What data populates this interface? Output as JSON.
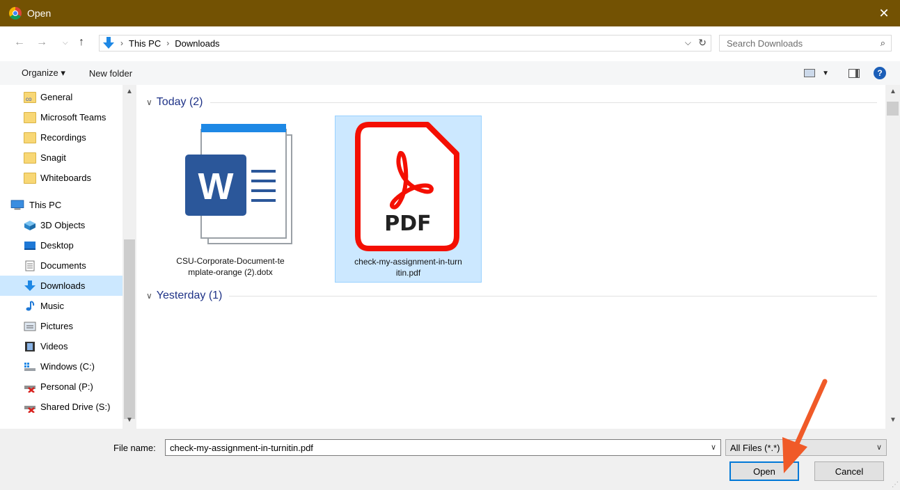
{
  "window": {
    "title": "Open",
    "close_glyph": "✕"
  },
  "address": {
    "breadcrumbs": [
      "This PC",
      "Downloads"
    ],
    "separator": "›",
    "search_placeholder": "Search Downloads"
  },
  "toolbar": {
    "organize_label": "Organize ▾",
    "new_folder_label": "New folder",
    "help_label": "?"
  },
  "nav": {
    "items": [
      {
        "label": "General"
      },
      {
        "label": "Microsoft Teams"
      },
      {
        "label": "Recordings"
      },
      {
        "label": "Snagit"
      },
      {
        "label": "Whiteboards"
      },
      {
        "label": "This PC"
      },
      {
        "label": "3D Objects"
      },
      {
        "label": "Desktop"
      },
      {
        "label": "Documents"
      },
      {
        "label": "Downloads"
      },
      {
        "label": "Music"
      },
      {
        "label": "Pictures"
      },
      {
        "label": "Videos"
      },
      {
        "label": "Windows (C:)"
      },
      {
        "label": "Personal (P:)"
      },
      {
        "label": "Shared Drive (S:)"
      }
    ]
  },
  "content": {
    "groups": [
      {
        "label": "Today (2)"
      },
      {
        "label": "Yesterday (1)"
      }
    ],
    "files": [
      {
        "line1": "CSU-Corporate-Document-te",
        "line2": "mplate-orange (2).dotx",
        "icon_letter": "W"
      },
      {
        "line1": "check-my-assignment-in-turn",
        "line2": "itin.pdf",
        "icon_label": "PDF",
        "selected": true
      }
    ]
  },
  "bottom": {
    "file_name_label": "File name:",
    "file_name_value": "check-my-assignment-in-turnitin.pdf",
    "filter_value": "All Files (*.*)",
    "open_label": "Open",
    "cancel_label": "Cancel"
  },
  "colors": {
    "titlebar": "#735203",
    "selection": "#cce8ff",
    "accent": "#0078d7",
    "arrow": "#f05a28"
  }
}
